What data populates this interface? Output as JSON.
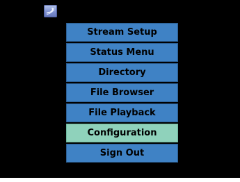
{
  "app": {
    "icon": "app-badge-icon"
  },
  "menu": {
    "selected_index": 5,
    "items": [
      {
        "label": "Stream Setup"
      },
      {
        "label": "Status Menu"
      },
      {
        "label": "Directory"
      },
      {
        "label": "File Browser"
      },
      {
        "label": "File Playback"
      },
      {
        "label": "Configuration"
      },
      {
        "label": "Sign Out"
      }
    ]
  },
  "colors": {
    "screen_background": "#000000",
    "menu_item": "#3f82c5",
    "menu_item_selected": "#8fd2bb",
    "menu_text": "#000000"
  }
}
